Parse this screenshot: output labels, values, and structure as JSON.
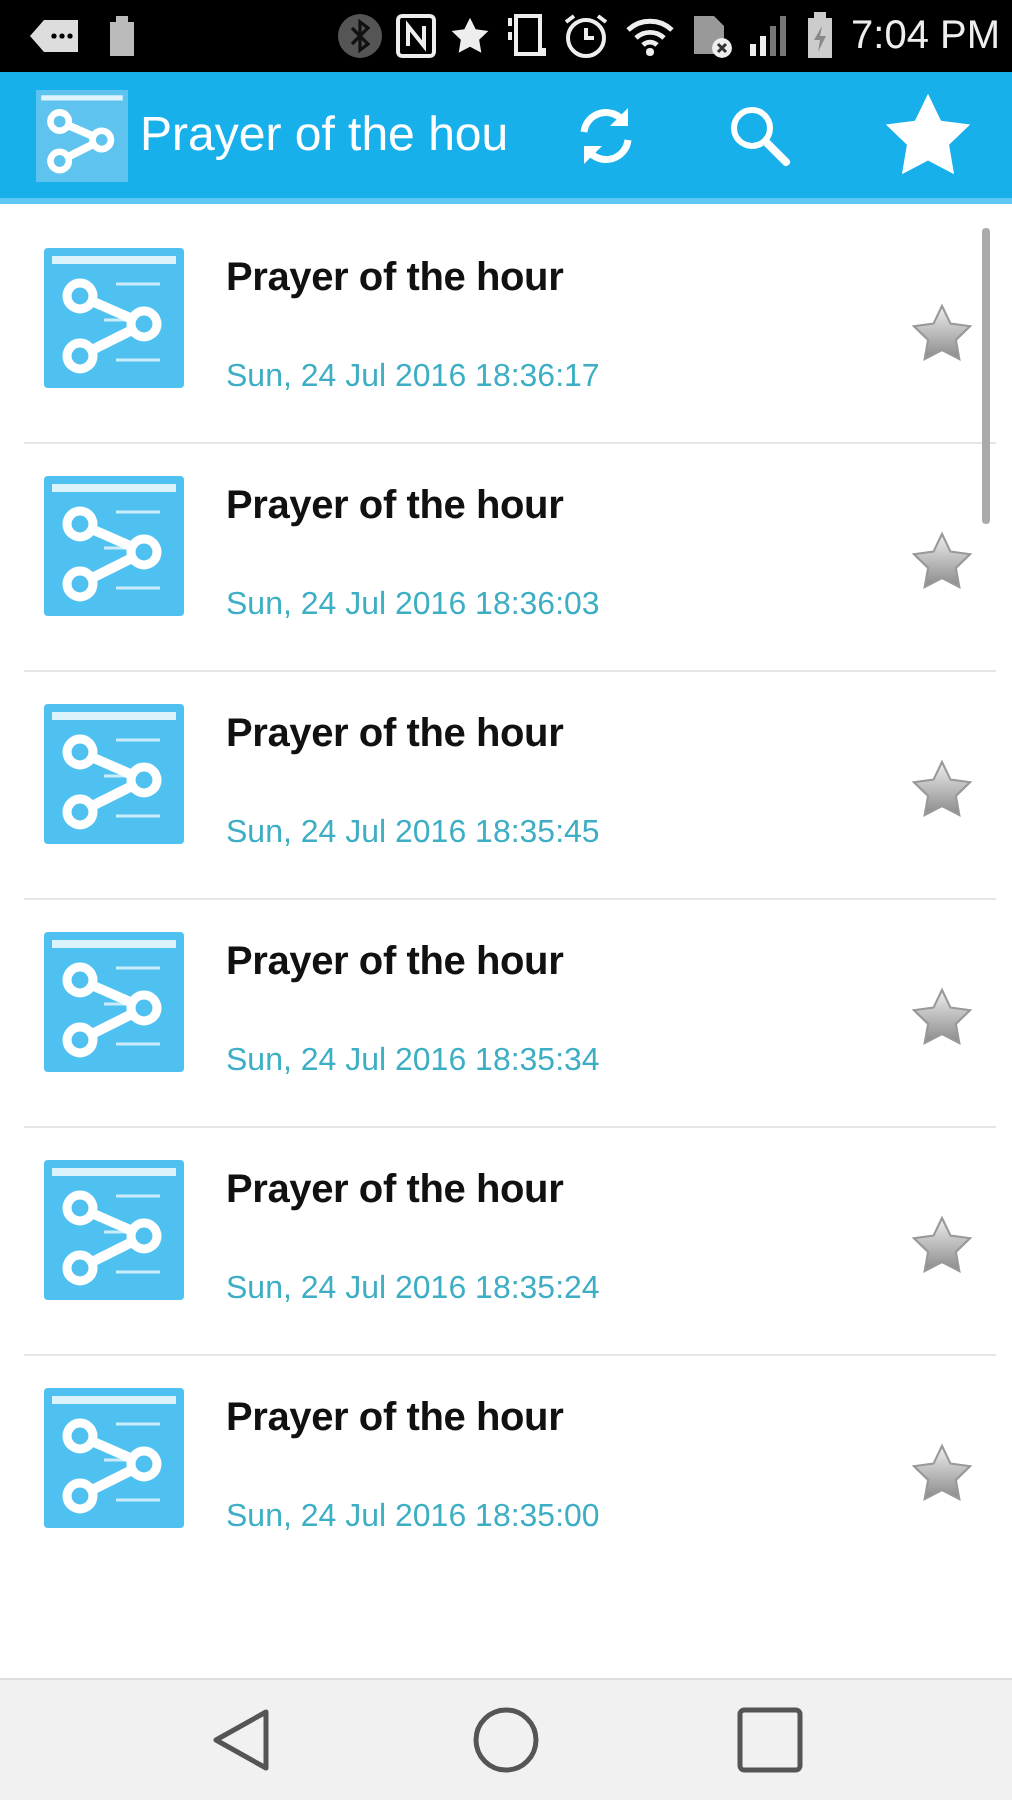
{
  "status_bar": {
    "time": "7:04 PM"
  },
  "app_bar": {
    "title": "Prayer of the hou"
  },
  "items": [
    {
      "title": "Prayer of the hour",
      "date": "Sun, 24 Jul 2016 18:36:17"
    },
    {
      "title": "Prayer of the hour",
      "date": "Sun, 24 Jul 2016 18:36:03"
    },
    {
      "title": "Prayer of the hour",
      "date": "Sun, 24 Jul 2016 18:35:45"
    },
    {
      "title": "Prayer of the hour",
      "date": "Sun, 24 Jul 2016 18:35:34"
    },
    {
      "title": "Prayer of the hour",
      "date": "Sun, 24 Jul 2016 18:35:24"
    },
    {
      "title": "Prayer of the hour",
      "date": "Sun, 24 Jul 2016 18:35:00"
    }
  ]
}
